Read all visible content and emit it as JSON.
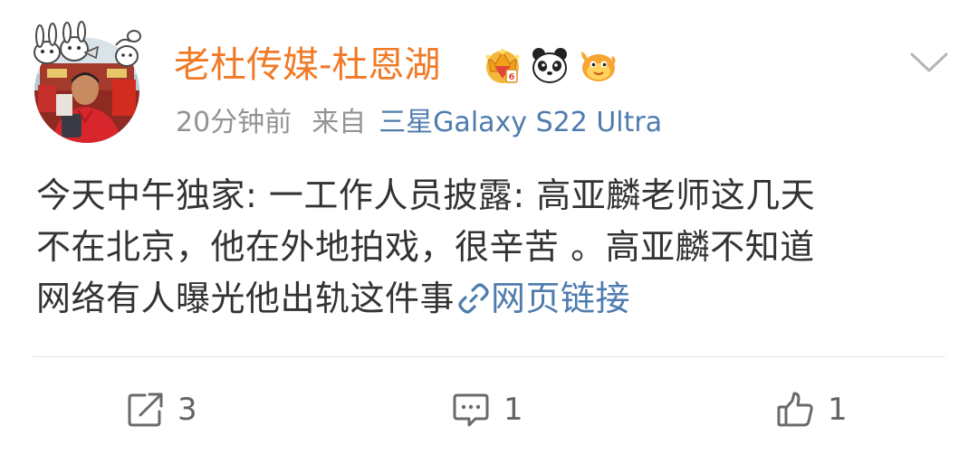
{
  "user": {
    "name": "老杜传媒-杜恩湖",
    "badges": [
      "crown-badge-icon",
      "panda-badge-icon",
      "fish-badge-icon"
    ]
  },
  "meta": {
    "time": "20分钟前",
    "source_prefix": "来自",
    "device": "三星Galaxy S22 Ultra"
  },
  "post": {
    "lines": [
      "今天中午独家: 一工作人员披露: 高亚麟老师这几天",
      "不在北京，他在外地拍戏，很辛苦 。高亚麟不知道",
      "网络有人曝光他出轨这件事"
    ],
    "link_text": "网页链接"
  },
  "actions": {
    "repost_count": "3",
    "comment_count": "1",
    "like_count": "1"
  },
  "colors": {
    "username": "#f07a25",
    "link": "#4f7cae",
    "meta": "#939393",
    "text": "#333333"
  }
}
